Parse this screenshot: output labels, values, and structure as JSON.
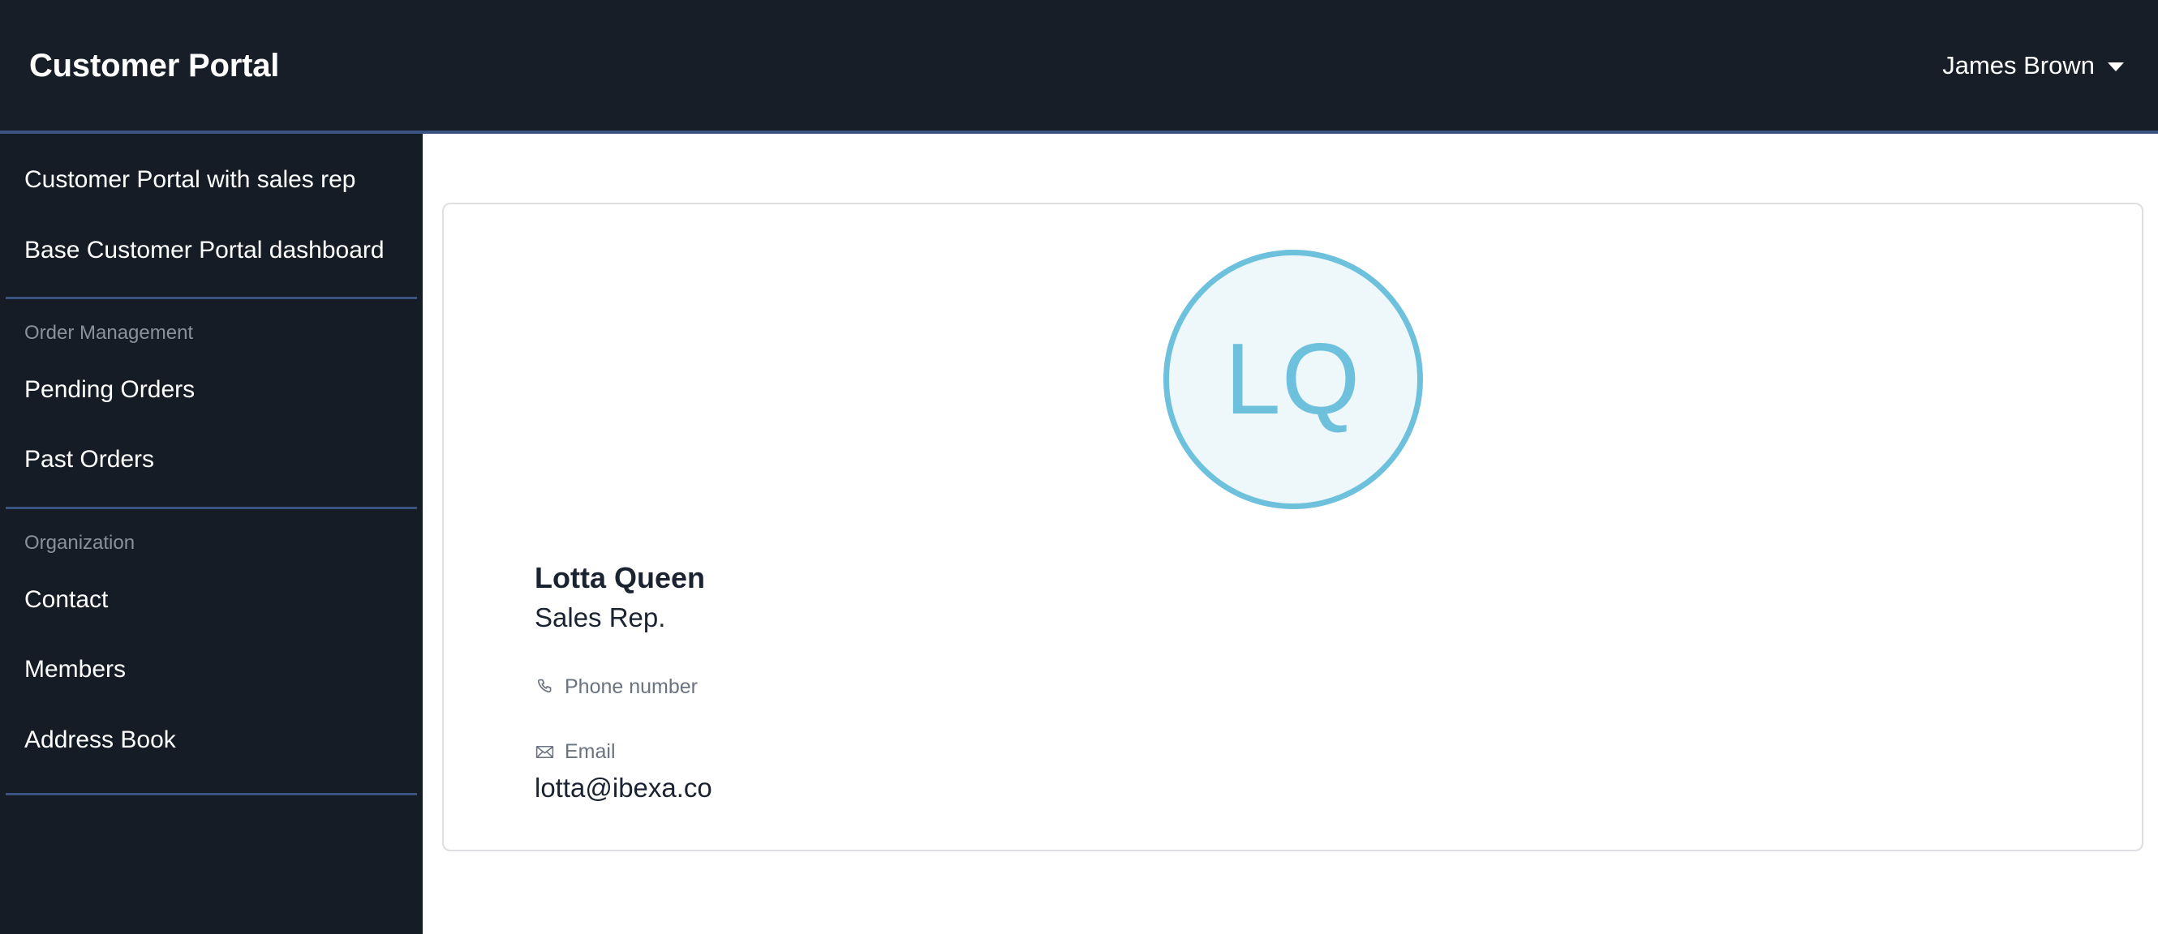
{
  "header": {
    "brand_title": "Customer Portal",
    "user_name": "James Brown",
    "caret_icon": "chevron-down-icon"
  },
  "sidebar": {
    "top_items": [
      {
        "label": "Customer Portal with sales rep"
      },
      {
        "label": "Base Customer Portal dashboard"
      }
    ],
    "sections": [
      {
        "label": "Order Management",
        "items": [
          {
            "label": "Pending Orders"
          },
          {
            "label": "Past Orders"
          }
        ]
      },
      {
        "label": "Organization",
        "items": [
          {
            "label": "Contact"
          },
          {
            "label": "Members"
          },
          {
            "label": "Address Book"
          }
        ]
      }
    ]
  },
  "main": {
    "card": {
      "avatar": {
        "initials": "LQ",
        "border_color": "#6ec1dd",
        "fill_color": "#eef7fa",
        "text_color": "#6ec1dd"
      },
      "person_name": "Lotta Queen",
      "person_role": "Sales Rep.",
      "fields": [
        {
          "icon": "phone-icon",
          "label": "Phone number",
          "value": ""
        },
        {
          "icon": "envelope-icon",
          "label": "Email",
          "value": "lotta@ibexa.co"
        }
      ]
    }
  },
  "colors": {
    "header_bg": "#171e28",
    "sidebar_bg": "#151c26",
    "divider": "#3a5380",
    "card_border": "#dedfe3",
    "muted_text": "#6b7280",
    "body_text": "#1c2330"
  }
}
